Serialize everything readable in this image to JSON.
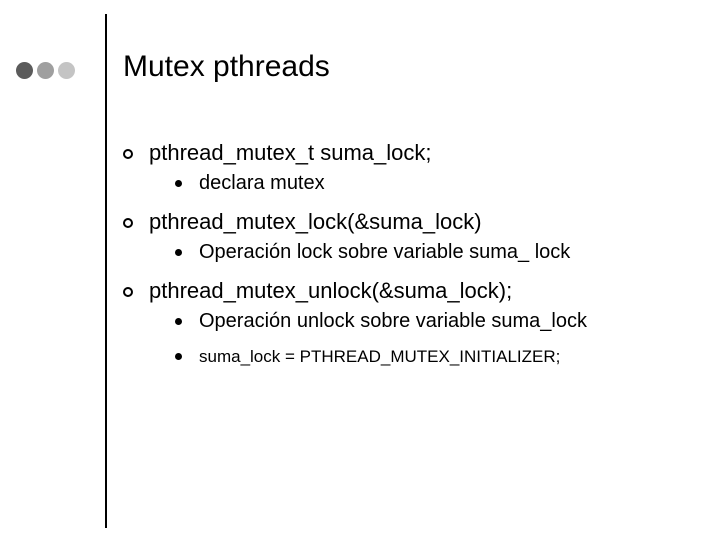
{
  "deco": {
    "dot_colors": [
      "#5b5b5b",
      "#9f9f9f",
      "#c4c4c4"
    ]
  },
  "title": "Mutex pthreads",
  "items": [
    {
      "text": "pthread_mutex_t suma_lock;",
      "sub": [
        {
          "text": "declara mutex",
          "small": false
        }
      ]
    },
    {
      "text": "pthread_mutex_lock(&suma_lock)",
      "sub": [
        {
          "text": "Operación lock sobre variable suma_ lock",
          "small": false
        }
      ]
    },
    {
      "text": "pthread_mutex_unlock(&suma_lock);",
      "sub": [
        {
          "text": "Operación unlock sobre variable suma_lock",
          "small": false
        },
        {
          "text": "suma_lock = PTHREAD_MUTEX_INITIALIZER;",
          "small": true
        }
      ]
    }
  ]
}
